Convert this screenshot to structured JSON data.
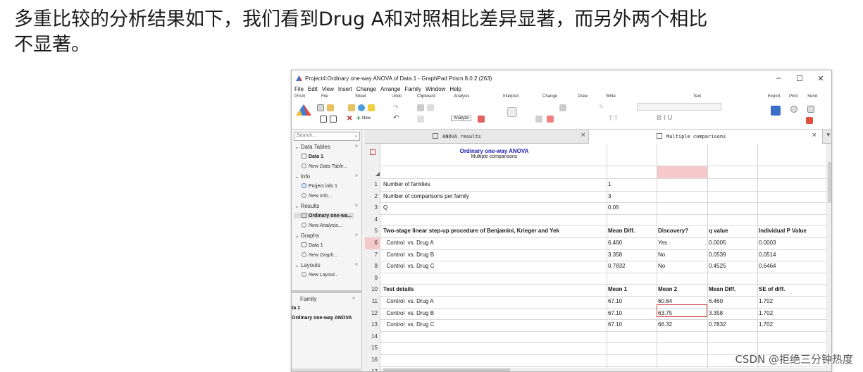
{
  "caption": {
    "line1": "多重比较的分析结果如下，我们看到Drug A和对照相比差异显著，而另外两个相比",
    "line2": "不显著。"
  },
  "window": {
    "title": "Project4:Ordinary one-way ANOVA of Data 1 - GraphPad Prism 8.0.2 (263)",
    "controls": [
      "–",
      "☐",
      "✕"
    ]
  },
  "menu": [
    "File",
    "Edit",
    "View",
    "Insert",
    "Change",
    "Arrange",
    "Family",
    "Window",
    "Help"
  ],
  "ribbon": {
    "groups": [
      "Prism",
      "File",
      "Sheet",
      "Undo",
      "Clipboard",
      "Analysis",
      "Interpret",
      "Change",
      "Draw",
      "Write",
      "Text",
      "Export",
      "Print",
      "Send"
    ],
    "new_label": "New",
    "analyze_label": "Analyze"
  },
  "sidebar": {
    "search_placeholder": "Search",
    "sections": [
      {
        "label": "Data Tables",
        "items": [
          "Data 1",
          "New Data Table..."
        ]
      },
      {
        "label": "Info",
        "items": [
          "Project info 1",
          "New Info..."
        ]
      },
      {
        "label": "Results",
        "items": [
          "Ordinary one-wa...",
          "New Analysis..."
        ]
      },
      {
        "label": "Graphs",
        "items": [
          "Data 1",
          "New Graph..."
        ]
      },
      {
        "label": "Layouts",
        "items": [
          "New Layout..."
        ]
      }
    ],
    "family": {
      "label": "Family",
      "item1": "ta 1",
      "item2": "Ordinary one-way ANOVA"
    }
  },
  "tabs": [
    {
      "label": "ANOVA results"
    },
    {
      "label": "Multiple comparisons"
    }
  ],
  "sheet": {
    "header_title": "Ordinary one-way ANOVA",
    "header_subtitle": "Multiple comparisons",
    "rows": [
      {
        "n": "1",
        "c1": "Number of families",
        "c2": "1",
        "c3": "",
        "c4": "",
        "c5": ""
      },
      {
        "n": "2",
        "c1": "Number of comparisons per family",
        "c2": "3",
        "c3": "",
        "c4": "",
        "c5": ""
      },
      {
        "n": "3",
        "c1": "Q",
        "c2": "0.05",
        "c3": "",
        "c4": "",
        "c5": ""
      },
      {
        "n": "4",
        "c1": "",
        "c2": "",
        "c3": "",
        "c4": "",
        "c5": ""
      },
      {
        "n": "5",
        "c1": "Two-stage linear step-up procedure of Benjamini, Krieger and Yek",
        "c2": "Mean Diff.",
        "c3": "Discovery?",
        "c4": "q value",
        "c5": "Individual P Value",
        "bold": true
      },
      {
        "n": "6",
        "c1": "  Control  vs. Drug A",
        "c2": "6.460",
        "c3": "Yes",
        "c4": "0.0005",
        "c5": "0.0003"
      },
      {
        "n": "7",
        "c1": "  Control  vs. Drug B",
        "c2": "3.358",
        "c3": "No",
        "c4": "0.0539",
        "c5": "0.0514"
      },
      {
        "n": "8",
        "c1": "  Control  vs. Drug C",
        "c2": "0.7832",
        "c3": "No",
        "c4": "0.4525",
        "c5": "0.6464"
      },
      {
        "n": "9",
        "c1": "",
        "c2": "",
        "c3": "",
        "c4": "",
        "c5": ""
      },
      {
        "n": "10",
        "c1": "Test details",
        "c2": "Mean 1",
        "c3": "Mean 2",
        "c4": "Mean Diff.",
        "c5": "SE of diff.",
        "bold": true
      },
      {
        "n": "11",
        "c1": "  Control  vs. Drug A",
        "c2": "67.10",
        "c3": "60.64",
        "c4": "6.460",
        "c5": "1.702"
      },
      {
        "n": "12",
        "c1": "  Control  vs. Drug B",
        "c2": "67.10",
        "c3": "63.75",
        "c4": "3.358",
        "c5": "1.702"
      },
      {
        "n": "13",
        "c1": "  Control  vs. Drug C",
        "c2": "67.10",
        "c3": "66.32",
        "c4": "0.7832",
        "c5": "1.702"
      },
      {
        "n": "14",
        "c1": "",
        "c2": "",
        "c3": "",
        "c4": "",
        "c5": ""
      },
      {
        "n": "15",
        "c1": "",
        "c2": "",
        "c3": "",
        "c4": "",
        "c5": ""
      },
      {
        "n": "16",
        "c1": "",
        "c2": "",
        "c3": "",
        "c4": "",
        "c5": ""
      },
      {
        "n": "17",
        "c1": "",
        "c2": "",
        "c3": "",
        "c4": "",
        "c5": ""
      }
    ],
    "selected_row": "6",
    "highlight_color": "#f5c9c9",
    "selection_border": "#d04040"
  },
  "watermark": "CSDN @拒绝三分钟热度"
}
